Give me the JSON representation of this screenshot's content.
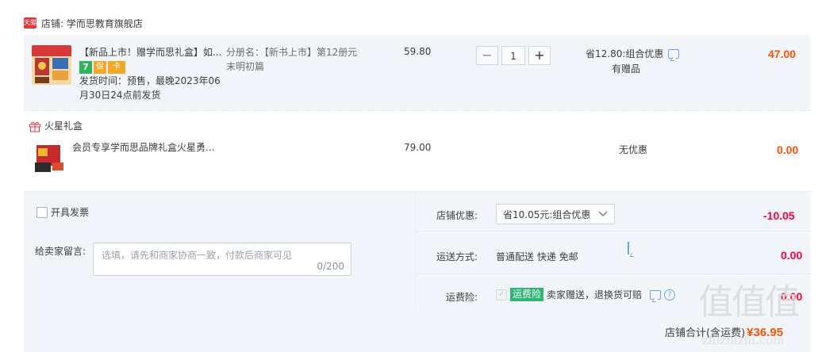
{
  "shop": {
    "badge": "天猫",
    "name": "店铺: 学而思教育旗舰店"
  },
  "item1": {
    "title": "【新品上市！赠学而思礼盒】如...",
    "badges": [
      "7",
      "保",
      "卡"
    ],
    "ship_line1": "发货时间：预售，最晚2023年06",
    "ship_line2": "月30日24点前发货",
    "sku_label": "分册名：",
    "sku_value": "【新书上市】第12册元",
    "sku_value2": "末明初篇",
    "price": "59.80",
    "quantity": "1",
    "promo": "省12.80:组合优惠",
    "gift": "有赠品",
    "total": "47.00"
  },
  "gift_section": {
    "label": "火星礼盒",
    "title": "会员专享学而思品牌礼盒火星勇...",
    "price": "79.00",
    "promo": "无优惠",
    "total": "0.00"
  },
  "invoice": {
    "label": "开具发票"
  },
  "message": {
    "label": "给卖家留言:",
    "placeholder": "选填，请先和商家协商一致，付款后商家可见",
    "counter": "0/200"
  },
  "shop_discount": {
    "label": "店铺优惠:",
    "selected": "省10.05元:组合优惠",
    "amount": "-10.05"
  },
  "shipping": {
    "label": "运送方式:",
    "value": "普通配送 快递 免邮",
    "amount": "0.00"
  },
  "insurance": {
    "label": "运费险:",
    "tag": "运费险",
    "text": "卖家赠送，退换货可赔",
    "amount": "0.00"
  },
  "summary": {
    "label": "店铺合计(含运费)",
    "amount": "¥36.95"
  },
  "watermark": {
    "main": "值值值",
    "sub": "zhizhizhi.com"
  },
  "colors": {
    "accent": "#ff5000",
    "discount": "#ff0036",
    "row_bg": "#f2f6fb",
    "link": "#6fa4dd"
  }
}
